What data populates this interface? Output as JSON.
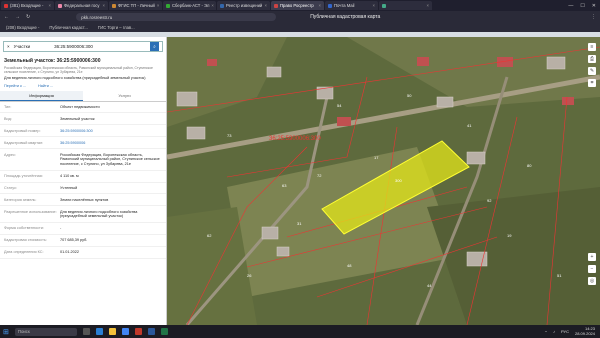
{
  "browser": {
    "tabs": [
      {
        "label": "(381) Входящие -",
        "color": "#d33"
      },
      {
        "label": "Федеральная госу",
        "color": "#e8a"
      },
      {
        "label": "ФГИС ТП - Личный",
        "color": "#c83"
      },
      {
        "label": "Сбербанк-АСТ - Эл",
        "color": "#3a3"
      },
      {
        "label": "Реестр извещений",
        "color": "#36a"
      },
      {
        "label": "Право Росреестр",
        "color": "#c44"
      },
      {
        "label": "Почта Mail",
        "color": "#36c"
      },
      {
        "label": "",
        "color": "#4a8"
      }
    ],
    "url": "pkk.rosreestr.ru",
    "page_title": "Публичная кадастровая карта",
    "bookmarks": [
      "(208) Входящие -",
      "Публичная кадаст...",
      "ГИС Торги – глав..."
    ]
  },
  "panel": {
    "search_type": "Участки",
    "search_value": "36:25:5900006:300",
    "title": "Земельный участок: 36:25:5900006:300",
    "subtitle": "Российская Федерация, Воронежская область, Рамонский муниципальный район, Ступинское сельское поселение, с Ступино, ул Зубарева, 21е",
    "purpose": "Для ведения личного подсобного хозяйства (приусадебный земельный участок)",
    "links": [
      "Перейти к ...",
      "Найти ..."
    ],
    "tabs": [
      "Информация",
      "Услуги"
    ],
    "rows": [
      {
        "k": "Тип:",
        "v": "Объект недвижимости",
        "link": false
      },
      {
        "k": "Вид:",
        "v": "Земельный участок",
        "link": false
      },
      {
        "k": "Кадастровый номер:",
        "v": "36:25:5900006:300",
        "link": true
      },
      {
        "k": "Кадастровый квартал:",
        "v": "36:25:5900006",
        "link": true
      },
      {
        "k": "Адрес:",
        "v": "Российская Федерация, Воронежская область, Рамонский муниципальный район, Ступинское сельское поселение, с Ступино, ул Зубарева, 21е",
        "link": false
      },
      {
        "k": "Площадь уточнённая:",
        "v": "4 110 кв. м",
        "link": false
      },
      {
        "k": "Статус:",
        "v": "Учтенный",
        "link": false
      },
      {
        "k": "Категория земель:",
        "v": "Земли населённых пунктов",
        "link": false
      },
      {
        "k": "Разрешенное использование:",
        "v": "Для ведения личного подсобного хозяйства (приусадебный земельный участок)",
        "link": false
      },
      {
        "k": "Форма собственности:",
        "v": "-",
        "link": false
      },
      {
        "k": "Кадастровая стоимость:",
        "v": "707 685,39 руб.",
        "link": false
      },
      {
        "k": "Дата определения КС:",
        "v": "01.01.2022",
        "link": false
      }
    ]
  },
  "map": {
    "selected_label": "36:25:5900006:300",
    "parcel_numbers": [
      "300",
      "54",
      "17",
      "63",
      "31",
      "73",
      "50",
      "41",
      "80",
      "26",
      "48",
      "44",
      "19",
      "51",
      "72",
      "92",
      "62"
    ]
  },
  "taskbar": {
    "search_placeholder": "Поиск",
    "lang": "РУС",
    "time": "14:23",
    "date": "28.09.2024"
  }
}
